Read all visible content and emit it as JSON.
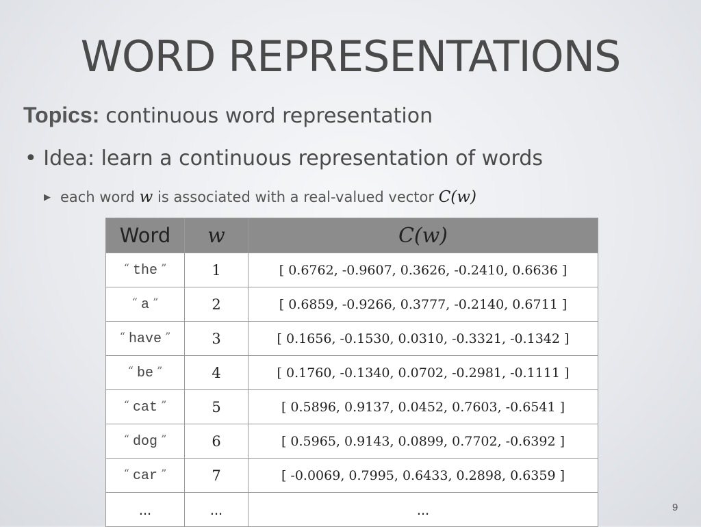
{
  "slide": {
    "title": "WORD REPRESENTATIONS",
    "topics_label": "Topics:",
    "topics_text": "continuous word representation",
    "bullet": "Idea: learn a continuous representation of words",
    "sub_prefix": "each word ",
    "sub_var": "w",
    "sub_mid": " is associated with a real-valued vector ",
    "sub_func": "C(w)",
    "page_number": "9"
  },
  "table": {
    "headers": [
      "Word",
      "w",
      "C(w)"
    ],
    "rows": [
      {
        "word": "the",
        "w": "1",
        "vector": "[ 0.6762, -0.9607, 0.3626, -0.2410, 0.6636 ]"
      },
      {
        "word": "a",
        "w": "2",
        "vector": "[ 0.6859, -0.9266, 0.3777, -0.2140, 0.6711 ]"
      },
      {
        "word": "have",
        "w": "3",
        "vector": "[ 0.1656, -0.1530, 0.0310, -0.3321, -0.1342 ]"
      },
      {
        "word": "be",
        "w": "4",
        "vector": "[ 0.1760, -0.1340, 0.0702, -0.2981, -0.1111 ]"
      },
      {
        "word": "cat",
        "w": "5",
        "vector": "[ 0.5896, 0.9137, 0.0452, 0.7603, -0.6541 ]"
      },
      {
        "word": "dog",
        "w": "6",
        "vector": "[ 0.5965, 0.9143, 0.0899, 0.7702, -0.6392 ]"
      },
      {
        "word": "car",
        "w": "7",
        "vector": "[ -0.0069, 0.7995, 0.6433, 0.2898, 0.6359 ]"
      }
    ],
    "ellipsis": [
      "...",
      "...",
      "..."
    ]
  }
}
